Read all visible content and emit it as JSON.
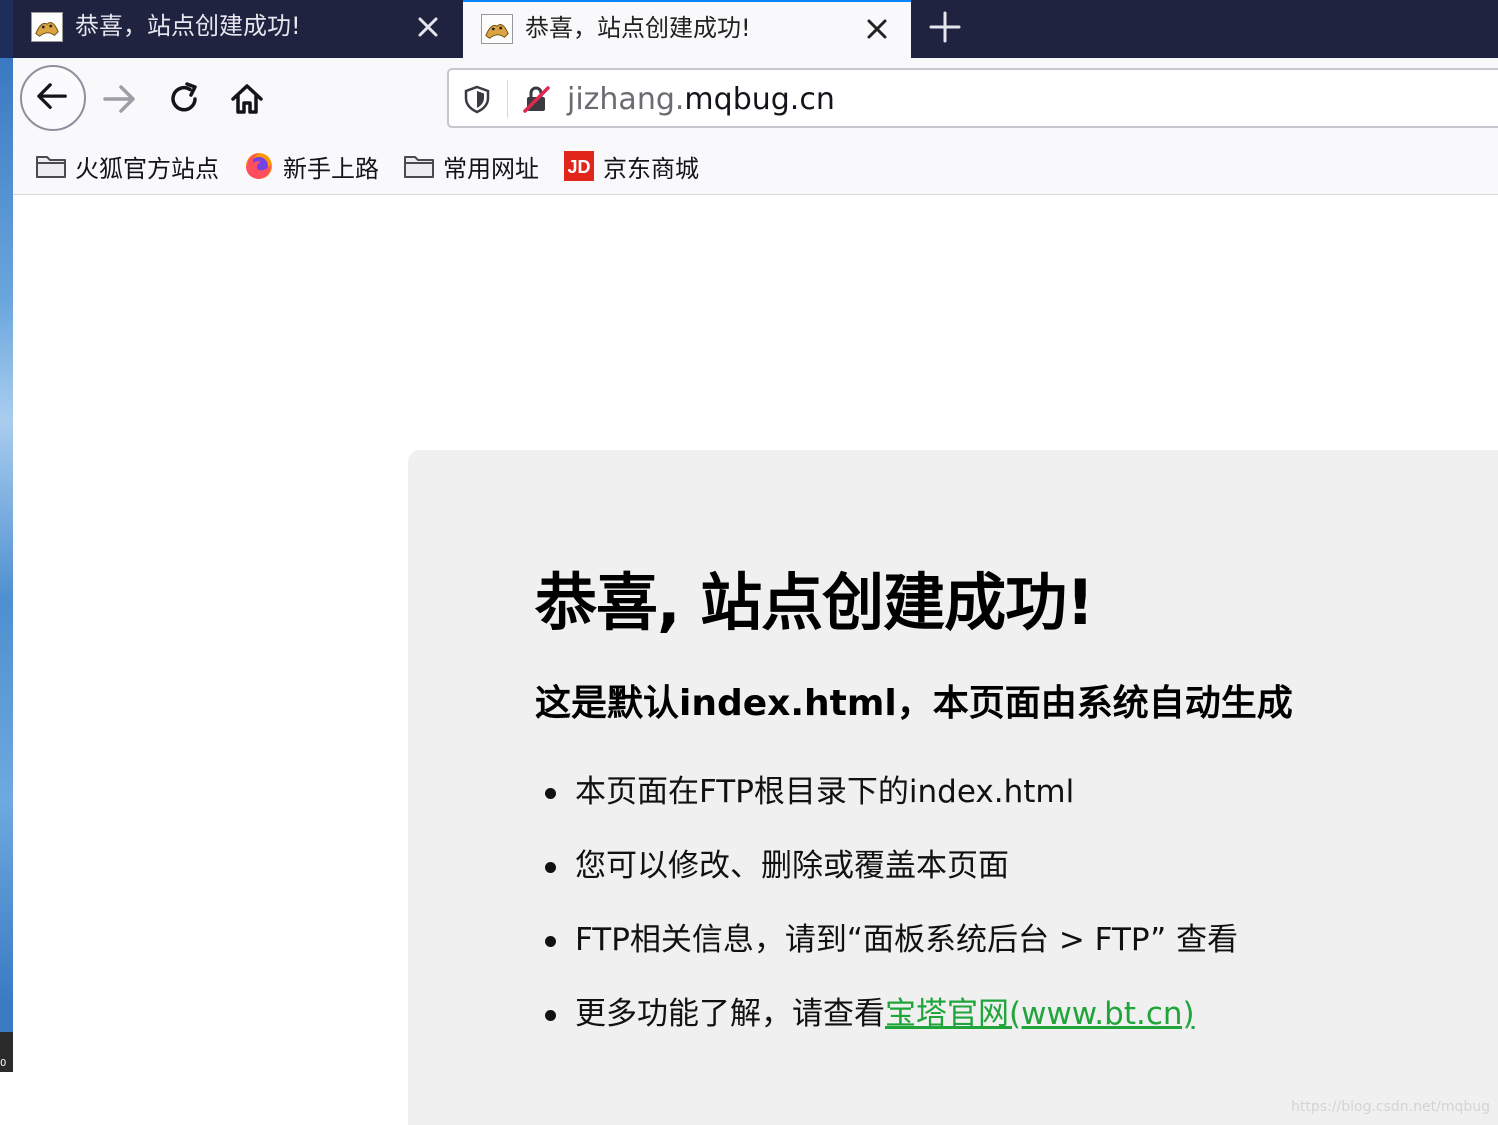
{
  "tabs": [
    {
      "title": "恭喜，站点创建成功!",
      "active": false
    },
    {
      "title": "恭喜，站点创建成功!",
      "active": true
    }
  ],
  "address_bar": {
    "url_subdomain": "jizhang.",
    "url_domain": "mqbug.cn"
  },
  "bookmarks": [
    {
      "label": "火狐官方站点",
      "icon": "folder-icon"
    },
    {
      "label": "新手上路",
      "icon": "firefox-icon"
    },
    {
      "label": "常用网址",
      "icon": "folder-icon"
    },
    {
      "label": "京东商城",
      "icon": "jd-icon",
      "icon_text": "JD"
    }
  ],
  "page": {
    "heading": "恭喜, 站点创建成功!",
    "subheading": "这是默认index.html，本页面由系统自动生成",
    "items": [
      "本页面在FTP根目录下的index.html",
      "您可以修改、删除或覆盖本页面",
      "FTP相关信息，请到“面板系统后台 > FTP” 查看"
    ],
    "last_item_prefix": "更多功能了解，请查看",
    "last_item_link": "宝塔官网(www.bt.cn)"
  },
  "watermark": "https://blog.csdn.net/mqbug",
  "desktop_corner_text": "0",
  "colors": {
    "tabbar_bg": "#202340",
    "active_tab_bg": "#f9f9fb",
    "card_bg": "#f0f0f0",
    "link_green": "#20a53a",
    "jd_red": "#e1251b"
  }
}
